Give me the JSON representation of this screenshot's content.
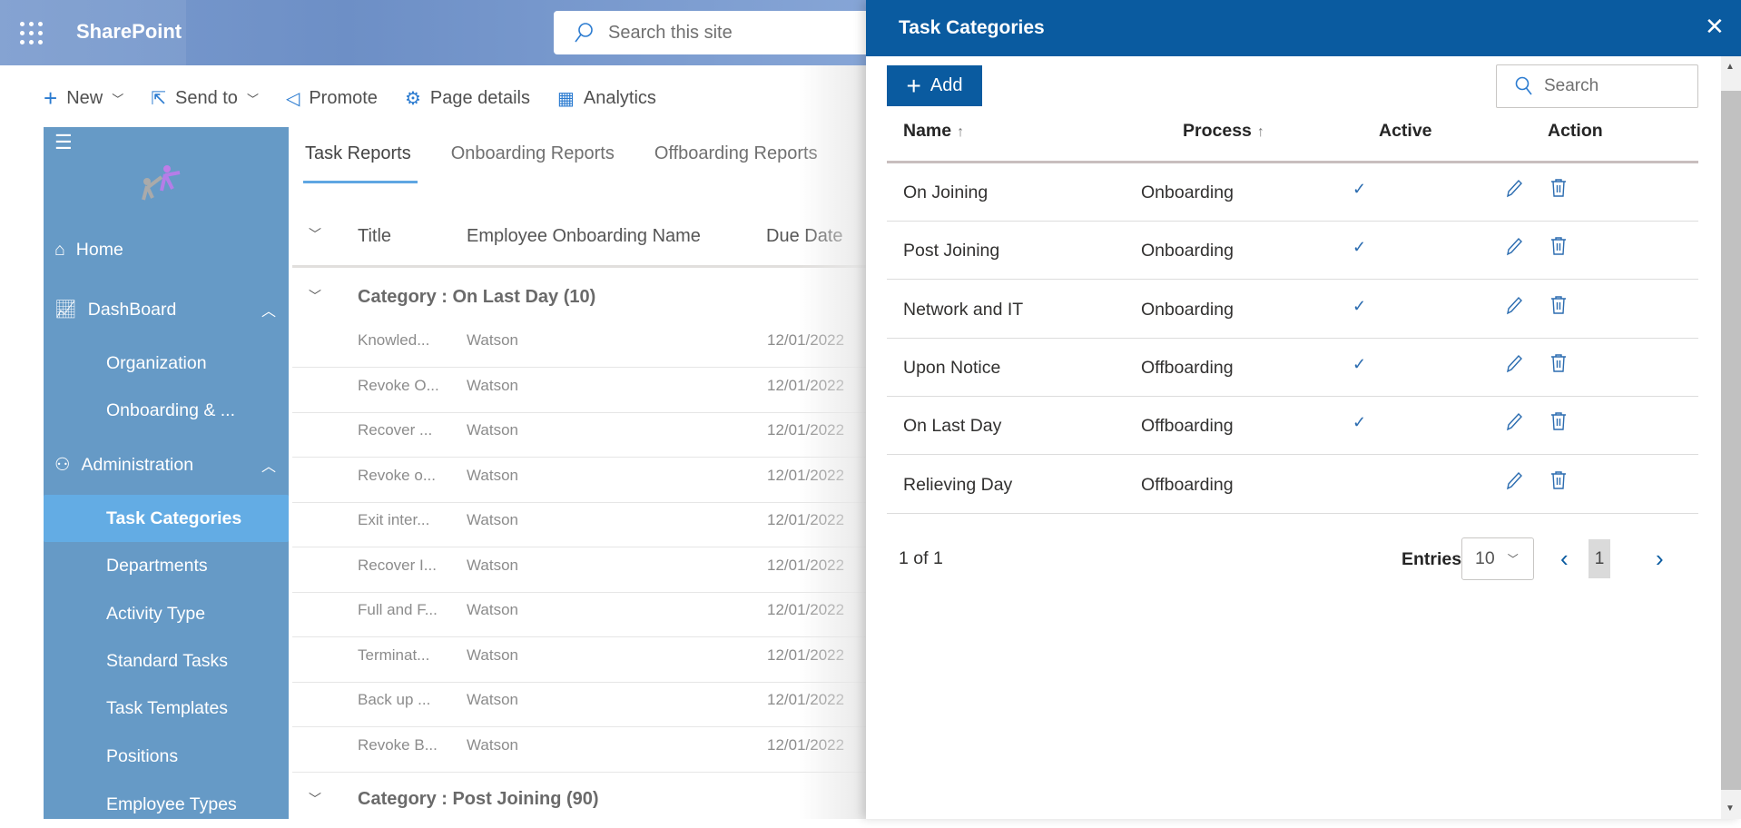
{
  "header": {
    "app_name": "SharePoint",
    "search_placeholder": "Search this site"
  },
  "command_bar": [
    {
      "label": "New",
      "icon": "plus-icon",
      "has_dropdown": true
    },
    {
      "label": "Send to",
      "icon": "share-icon",
      "has_dropdown": true
    },
    {
      "label": "Promote",
      "icon": "megaphone-icon"
    },
    {
      "label": "Page details",
      "icon": "gear-icon"
    },
    {
      "label": "Analytics",
      "icon": "chart-icon"
    }
  ],
  "sidebar": {
    "items": [
      {
        "label": "Home",
        "icon": "home-icon",
        "type": "top"
      },
      {
        "label": "DashBoard",
        "icon": "chart-line-icon",
        "type": "top",
        "expanded": true
      },
      {
        "label": "Organization",
        "type": "sub"
      },
      {
        "label": "Onboarding & ...",
        "type": "sub"
      },
      {
        "label": "Administration",
        "icon": "user-settings-icon",
        "type": "top",
        "expanded": true
      },
      {
        "label": "Task Categories",
        "type": "sub",
        "selected": true
      },
      {
        "label": "Departments",
        "type": "sub"
      },
      {
        "label": "Activity Type",
        "type": "sub"
      },
      {
        "label": "Standard Tasks",
        "type": "sub"
      },
      {
        "label": "Task Templates",
        "type": "sub"
      },
      {
        "label": "Positions",
        "type": "sub"
      },
      {
        "label": "Employee Types",
        "type": "sub"
      }
    ]
  },
  "tabs": [
    {
      "label": "Task Reports",
      "active": true
    },
    {
      "label": "Onboarding Reports"
    },
    {
      "label": "Offboarding Reports"
    }
  ],
  "list": {
    "columns": [
      "Title",
      "Employee Onboarding Name",
      "Due Date"
    ],
    "groups": [
      {
        "label": "Category : On Last Day (10)",
        "rows": [
          [
            "Knowled...",
            "Watson",
            "12/01/2022"
          ],
          [
            "Revoke O...",
            "Watson",
            "12/01/2022"
          ],
          [
            "Recover ...",
            "Watson",
            "12/01/2022"
          ],
          [
            "Revoke o...",
            "Watson",
            "12/01/2022"
          ],
          [
            "Exit inter...",
            "Watson",
            "12/01/2022"
          ],
          [
            "Recover I...",
            "Watson",
            "12/01/2022"
          ],
          [
            "Full and F...",
            "Watson",
            "12/01/2022"
          ],
          [
            "Terminat...",
            "Watson",
            "12/01/2022"
          ],
          [
            "Back up ...",
            "Watson",
            "12/01/2022"
          ],
          [
            "Revoke B...",
            "Watson",
            "12/01/2022"
          ]
        ]
      },
      {
        "label": "Category : Post Joining (90)",
        "rows": []
      }
    ]
  },
  "panel": {
    "title": "Task Categories",
    "add_label": "Add",
    "search_placeholder": "Search",
    "columns": {
      "name": "Name",
      "process": "Process",
      "active": "Active",
      "action": "Action",
      "sort_arrow": "↑"
    },
    "rows": [
      {
        "name": "On Joining",
        "process": "Onboarding",
        "active": true
      },
      {
        "name": "Post Joining",
        "process": "Onboarding",
        "active": true
      },
      {
        "name": "Network and IT",
        "process": "Onboarding",
        "active": true
      },
      {
        "name": "Upon Notice",
        "process": "Offboarding",
        "active": true
      },
      {
        "name": "On Last Day",
        "process": "Offboarding",
        "active": true
      },
      {
        "name": "Relieving Day",
        "process": "Offboarding",
        "active": false
      }
    ],
    "pagination": {
      "info": "1 of 1",
      "entries_label": "Entries",
      "entries_value": "10",
      "current_page": "1"
    },
    "colors": {
      "header": "#0a5ba0",
      "sidebar": "#669ac6",
      "selected": "#63ace4"
    }
  }
}
